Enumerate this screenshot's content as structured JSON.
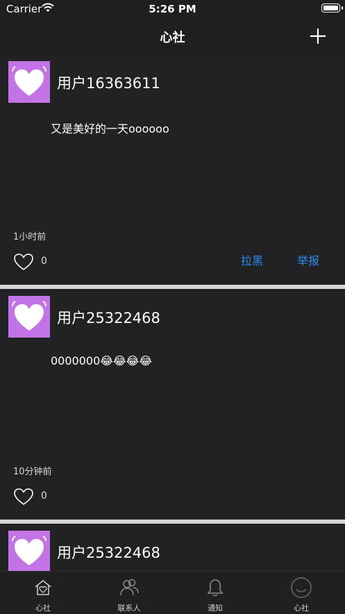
{
  "status_bar": {
    "carrier": "Carrier",
    "time": "5:26 PM"
  },
  "nav": {
    "title": "心社"
  },
  "posts": [
    {
      "username": "用户16363611",
      "content": "又是美好的一天oooooo",
      "time": "1小时前",
      "likes": "0",
      "block_label": "拉黑",
      "report_label": "举报"
    },
    {
      "username": "用户25322468",
      "content": "0000000😂😂😂😂",
      "time": "10分钟前",
      "likes": "0"
    },
    {
      "username": "用户25322468"
    }
  ],
  "tabs": [
    {
      "label": "心社",
      "icon": "home-heart-icon"
    },
    {
      "label": "联系人",
      "icon": "contacts-icon"
    },
    {
      "label": "通知",
      "icon": "bell-icon"
    },
    {
      "label": "心社",
      "icon": "profile-circle-icon"
    }
  ],
  "colors": {
    "accent_link": "#2d8cf0",
    "avatar_bg": "#c273e6",
    "separator": "#d6d6d6"
  }
}
